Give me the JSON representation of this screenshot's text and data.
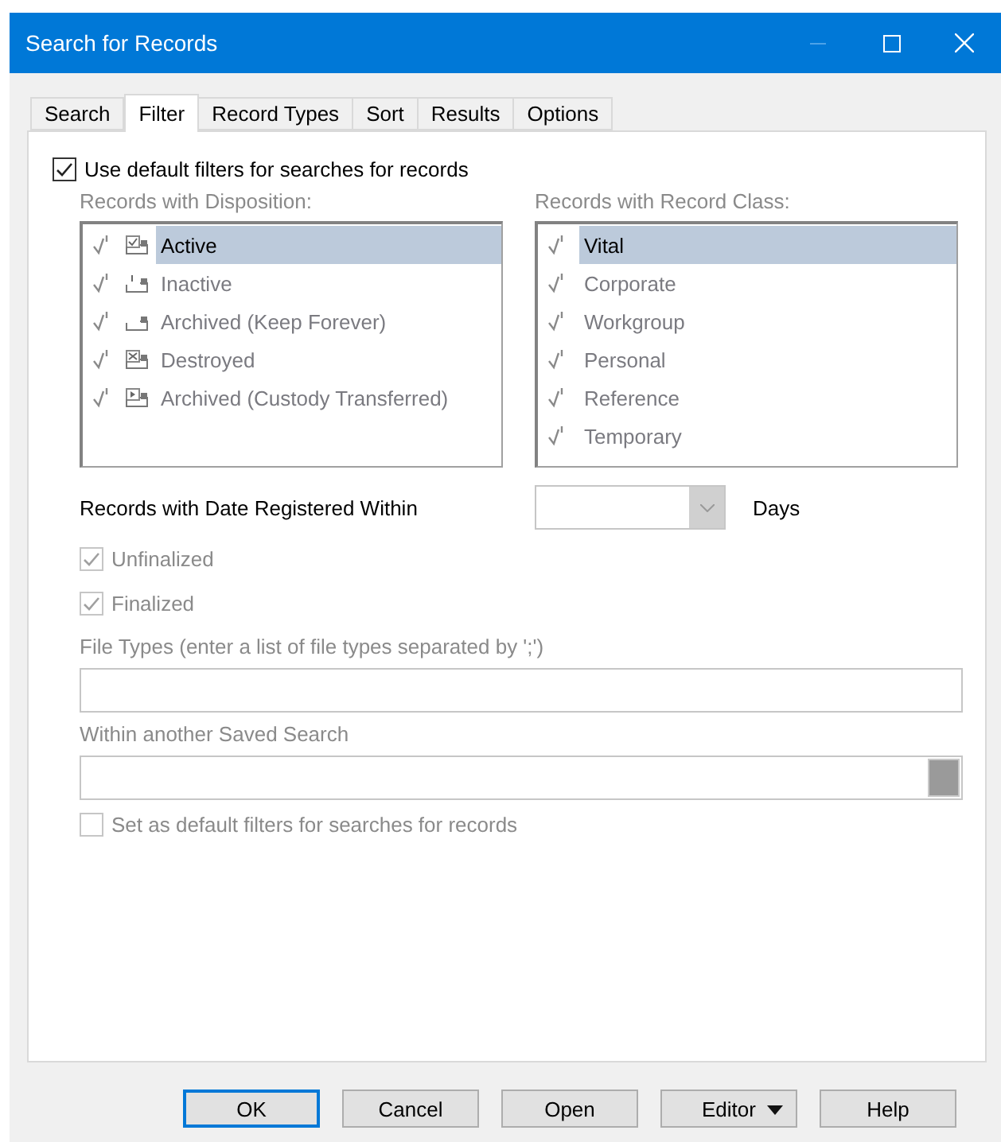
{
  "window": {
    "title": "Search for Records"
  },
  "tabs": [
    {
      "label": "Search",
      "selected": false
    },
    {
      "label": "Filter",
      "selected": true
    },
    {
      "label": "Record Types",
      "selected": false
    },
    {
      "label": "Sort",
      "selected": false
    },
    {
      "label": "Results",
      "selected": false
    },
    {
      "label": "Options",
      "selected": false
    }
  ],
  "use_default_filters": {
    "label": "Use default filters for searches for records",
    "checked": true
  },
  "disposition": {
    "label": "Records with Disposition:",
    "items": [
      {
        "label": "Active",
        "kind": "active",
        "checked": true,
        "selected": true
      },
      {
        "label": "Inactive",
        "kind": "inactive",
        "checked": true,
        "selected": false
      },
      {
        "label": "Archived (Keep Forever)",
        "kind": "kept",
        "checked": true,
        "selected": false
      },
      {
        "label": "Destroyed",
        "kind": "destroyed",
        "checked": true,
        "selected": false
      },
      {
        "label": "Archived (Custody Transferred)",
        "kind": "transferred",
        "checked": true,
        "selected": false
      }
    ]
  },
  "record_class": {
    "label": "Records with Record Class:",
    "items": [
      {
        "label": "Vital",
        "checked": true,
        "selected": true
      },
      {
        "label": "Corporate",
        "checked": true,
        "selected": false
      },
      {
        "label": "Workgroup",
        "checked": true,
        "selected": false
      },
      {
        "label": "Personal",
        "checked": true,
        "selected": false
      },
      {
        "label": "Reference",
        "checked": true,
        "selected": false
      },
      {
        "label": "Temporary",
        "checked": true,
        "selected": false
      }
    ]
  },
  "date_registered": {
    "label": "Records with Date Registered Within",
    "unit": "Days",
    "disabled": true
  },
  "finalization": [
    {
      "label": "Unfinalized",
      "checked": true,
      "disabled": true
    },
    {
      "label": "Finalized",
      "checked": true,
      "disabled": true
    }
  ],
  "file_types": {
    "label": "File Types (enter a list of file types separated by ';')"
  },
  "saved_search": {
    "label": "Within another Saved Search"
  },
  "set_default": {
    "label": "Set as default filters for searches for records",
    "checked": false,
    "disabled": true
  },
  "buttons": [
    {
      "label": "OK",
      "kind": "default"
    },
    {
      "label": "Cancel",
      "kind": "plain"
    },
    {
      "label": "Open",
      "kind": "plain"
    },
    {
      "label": "Editor",
      "kind": "menu"
    },
    {
      "label": "Help",
      "kind": "plain"
    }
  ]
}
